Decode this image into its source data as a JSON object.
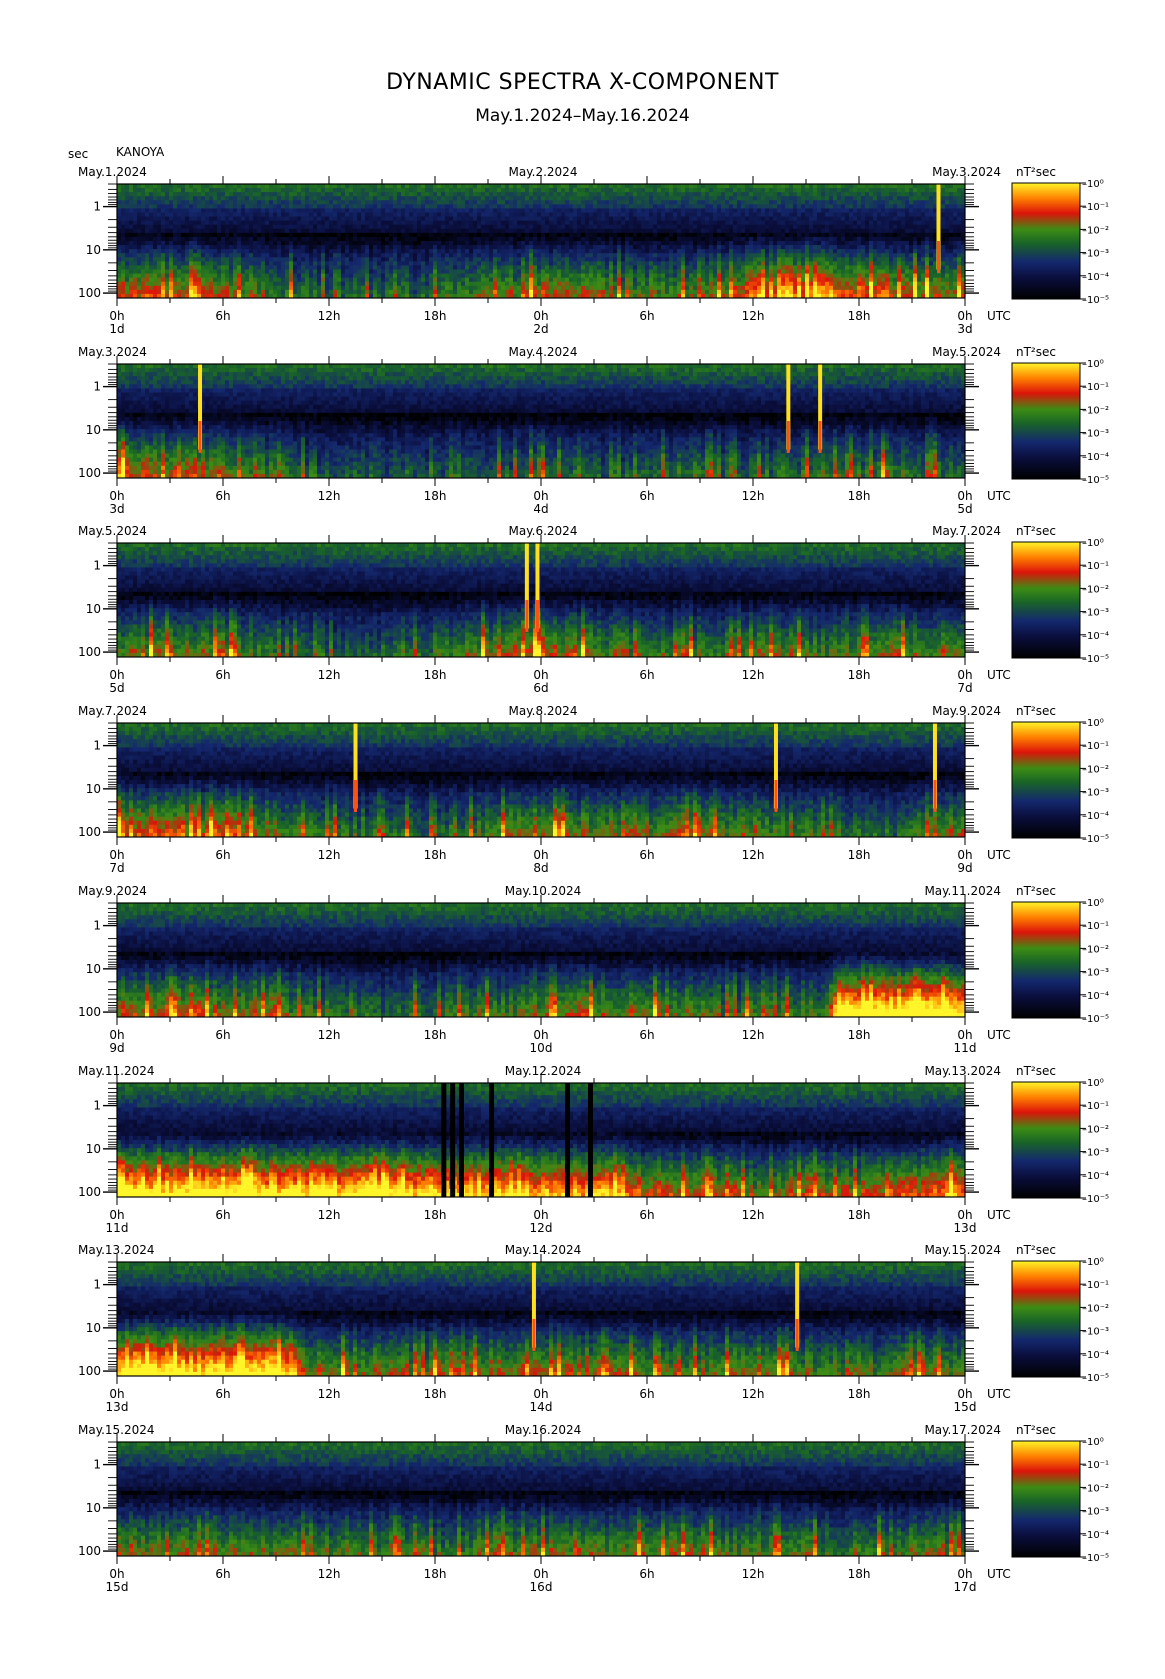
{
  "header": {
    "title": "DYNAMIC SPECTRA X-COMPONENT",
    "subtitle": "May.1.2024–May.16.2024",
    "y_unit": "sec",
    "station": "KANOYA"
  },
  "chart_data": {
    "type": "heatmap",
    "y_axis": {
      "label": "sec",
      "ticks": [
        "1",
        "10",
        "100"
      ],
      "scale": "log",
      "range": [
        0.3,
        130
      ]
    },
    "x_axis": {
      "label": "UTC",
      "ticks": [
        "0h",
        "6h",
        "12h",
        "18h",
        "0h",
        "6h",
        "12h",
        "18h",
        "0h"
      ]
    },
    "colorbar": {
      "label": "nT²sec",
      "ticks": [
        "10⁰",
        "10⁻¹",
        "10⁻²",
        "10⁻³",
        "10⁻⁴",
        "10⁻⁵"
      ]
    },
    "panels": [
      {
        "left_date": "May.1.2024",
        "mid_date": "May.2.2024",
        "right_date": "May.3.2024",
        "day_start": "1d",
        "day_mid": "2d",
        "day_end": "3d",
        "activity": [
          [
            0,
            0.55
          ],
          [
            4,
            0.6
          ],
          [
            8,
            0.5
          ],
          [
            12,
            0.3
          ],
          [
            18,
            0.35
          ],
          [
            24,
            0.55
          ],
          [
            30,
            0.45
          ],
          [
            34,
            0.5
          ],
          [
            36,
            0.65
          ],
          [
            40,
            0.75
          ],
          [
            44,
            0.6
          ],
          [
            48,
            0.55
          ]
        ],
        "spikes": [
          46.5
        ],
        "gaps": []
      },
      {
        "left_date": "May.3.2024",
        "mid_date": "May.4.2024",
        "right_date": "May.5.2024",
        "day_start": "3d",
        "day_mid": "4d",
        "day_end": "5d",
        "activity": [
          [
            0,
            0.65
          ],
          [
            4,
            0.55
          ],
          [
            8,
            0.45
          ],
          [
            12,
            0.3
          ],
          [
            18,
            0.3
          ],
          [
            24,
            0.35
          ],
          [
            30,
            0.3
          ],
          [
            36,
            0.35
          ],
          [
            40,
            0.4
          ],
          [
            44,
            0.4
          ],
          [
            48,
            0.35
          ]
        ],
        "spikes": [
          4.7,
          38.0,
          39.8
        ],
        "gaps": []
      },
      {
        "left_date": "May.5.2024",
        "mid_date": "May.6.2024",
        "right_date": "May.7.2024",
        "day_start": "5d",
        "day_mid": "6d",
        "day_end": "7d",
        "activity": [
          [
            0,
            0.5
          ],
          [
            6,
            0.5
          ],
          [
            10,
            0.35
          ],
          [
            14,
            0.3
          ],
          [
            20,
            0.45
          ],
          [
            23,
            0.6
          ],
          [
            26,
            0.5
          ],
          [
            30,
            0.45
          ],
          [
            36,
            0.45
          ],
          [
            42,
            0.45
          ],
          [
            48,
            0.5
          ]
        ],
        "spikes": [
          23.2,
          23.8
        ],
        "gaps": []
      },
      {
        "left_date": "May.7.2024",
        "mid_date": "May.8.2024",
        "right_date": "May.9.2024",
        "day_start": "7d",
        "day_mid": "8d",
        "day_end": "9d",
        "activity": [
          [
            0,
            0.65
          ],
          [
            6,
            0.6
          ],
          [
            10,
            0.45
          ],
          [
            14,
            0.35
          ],
          [
            18,
            0.35
          ],
          [
            22,
            0.5
          ],
          [
            28,
            0.5
          ],
          [
            34,
            0.5
          ],
          [
            40,
            0.4
          ],
          [
            44,
            0.35
          ],
          [
            48,
            0.55
          ]
        ],
        "spikes": [
          13.5,
          37.3,
          46.3
        ],
        "gaps": []
      },
      {
        "left_date": "May.9.2024",
        "mid_date": "May.10.2024",
        "right_date": "May.11.2024",
        "day_start": "9d",
        "day_mid": "10d",
        "day_end": "11d",
        "activity": [
          [
            0,
            0.55
          ],
          [
            6,
            0.55
          ],
          [
            12,
            0.4
          ],
          [
            18,
            0.35
          ],
          [
            24,
            0.5
          ],
          [
            30,
            0.5
          ],
          [
            36,
            0.4
          ],
          [
            40,
            0.45
          ],
          [
            41,
            0.95
          ],
          [
            44,
            0.95
          ],
          [
            48,
            0.95
          ]
        ],
        "spikes": [],
        "gaps": []
      },
      {
        "left_date": "May.11.2024",
        "mid_date": "May.12.2024",
        "right_date": "May.13.2024",
        "day_start": "11d",
        "day_mid": "12d",
        "day_end": "13d",
        "activity": [
          [
            0,
            0.95
          ],
          [
            6,
            0.9
          ],
          [
            12,
            0.9
          ],
          [
            18,
            0.85
          ],
          [
            24,
            0.8
          ],
          [
            28,
            0.8
          ],
          [
            30,
            0.6
          ],
          [
            36,
            0.5
          ],
          [
            42,
            0.55
          ],
          [
            46,
            0.7
          ],
          [
            48,
            0.75
          ]
        ],
        "spikes": [],
        "gaps": [
          18.5,
          19.0,
          19.5,
          21.2,
          25.5,
          26.8
        ]
      },
      {
        "left_date": "May.13.2024",
        "mid_date": "May.14.2024",
        "right_date": "May.15.2024",
        "day_start": "13d",
        "day_mid": "14d",
        "day_end": "15d",
        "activity": [
          [
            0,
            0.9
          ],
          [
            6,
            0.9
          ],
          [
            10,
            0.85
          ],
          [
            11,
            0.5
          ],
          [
            18,
            0.5
          ],
          [
            24,
            0.55
          ],
          [
            30,
            0.5
          ],
          [
            36,
            0.5
          ],
          [
            42,
            0.45
          ],
          [
            48,
            0.5
          ]
        ],
        "spikes": [
          23.6,
          38.5
        ],
        "gaps": []
      },
      {
        "left_date": "May.15.2024",
        "mid_date": "May.16.2024",
        "right_date": "May.17.2024",
        "day_start": "15d",
        "day_mid": "16d",
        "day_end": "17d",
        "activity": [
          [
            0,
            0.5
          ],
          [
            6,
            0.5
          ],
          [
            12,
            0.45
          ],
          [
            18,
            0.4
          ],
          [
            24,
            0.5
          ],
          [
            30,
            0.5
          ],
          [
            36,
            0.45
          ],
          [
            40,
            0.4
          ],
          [
            44,
            0.45
          ],
          [
            48,
            0.5
          ]
        ],
        "spikes": [],
        "gaps": []
      }
    ]
  }
}
